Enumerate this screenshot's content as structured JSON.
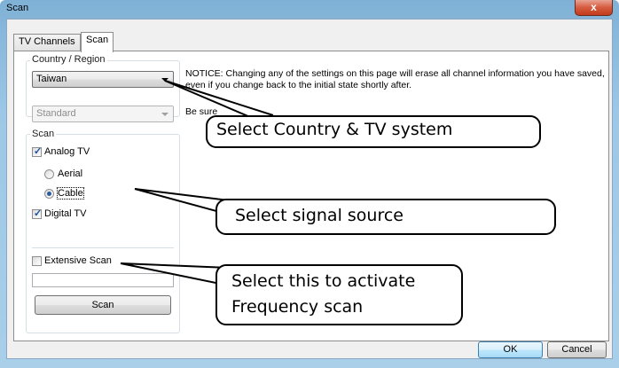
{
  "window": {
    "title": "Scan",
    "close_glyph": "x"
  },
  "tabs": [
    {
      "label": "TV Channels",
      "active": false
    },
    {
      "label": "Scan",
      "active": true
    }
  ],
  "country_group": {
    "label": "Country / Region",
    "selected": "Taiwan",
    "standard_value": "Standard"
  },
  "scan_group": {
    "label": "Scan",
    "analog_tv": {
      "label": "Analog TV",
      "checked": true
    },
    "aerial": {
      "label": "Aerial",
      "selected": false
    },
    "cable": {
      "label": "Cable",
      "selected": true
    },
    "digital_tv": {
      "label": "Digital TV",
      "checked": true
    }
  },
  "extensive_scan": {
    "label": "Extensive Scan",
    "checked": false
  },
  "scan_button": "Scan",
  "notice": {
    "line1": "NOTICE: Changing any of the settings on this page will erase all channel information you have saved,",
    "line2": "even if you change back to the initial state shortly after.",
    "line3": "Be sure"
  },
  "footer": {
    "ok": "OK",
    "cancel": "Cancel"
  },
  "callouts": {
    "country": "Select Country & TV system",
    "signal": "Select signal source",
    "frequency_line1": "Select this to activate",
    "frequency_line2": "Frequency scan"
  }
}
